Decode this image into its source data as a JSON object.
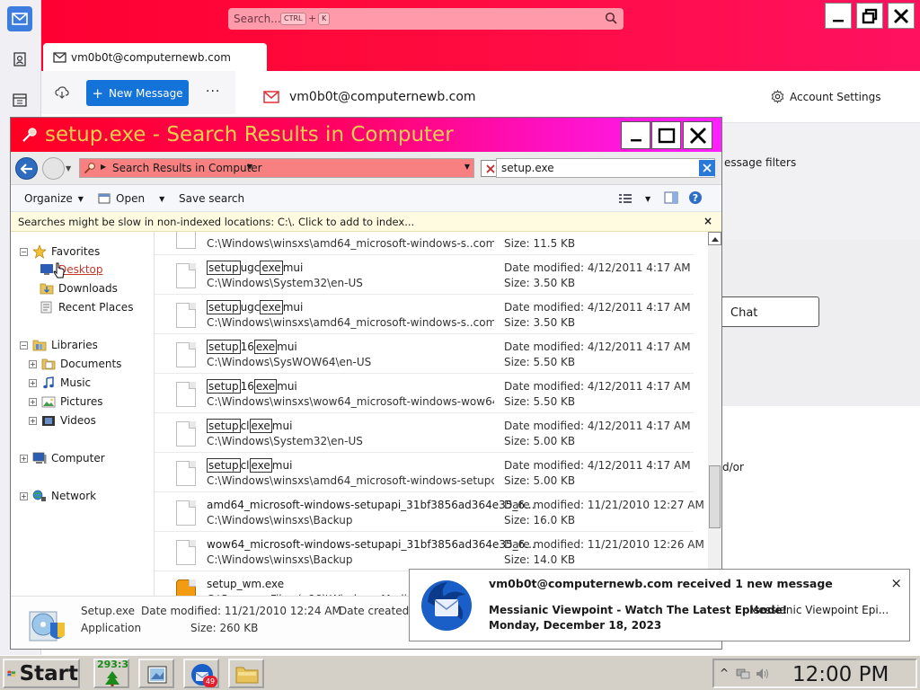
{
  "thunderbird": {
    "search_placeholder": "Search...",
    "kbd_ctrl": "CTRL",
    "kbd_plus": "+",
    "kbd_k": "K",
    "tab_label": "vm0b0t@computernewb.com",
    "new_message_label": "New Message",
    "more_label": "···",
    "header_title": "vm0b0t@computernewb.com",
    "account_settings_label": "Account Settings",
    "message_filters_fragment": "essage filters",
    "chat_label": "Chat",
    "and_or_fragment": "d/or"
  },
  "explorer": {
    "title": "setup.exe - Search Results in Computer",
    "address_text": "Search Results in Computer",
    "search_value": "setup.exe",
    "commands": {
      "organize": "Organize",
      "open": "Open",
      "save_search": "Save search"
    },
    "infobar_text": "Searches might be slow in non-indexed locations: C:\\. Click to add to index...",
    "infobar_close": "×",
    "nav": {
      "favorites": "Favorites",
      "desktop": "Desktop",
      "downloads": "Downloads",
      "recent_places": "Recent Places",
      "libraries": "Libraries",
      "documents": "Documents",
      "music": "Music",
      "pictures": "Pictures",
      "videos": "Videos",
      "computer": "Computer",
      "network": "Network"
    },
    "results": [
      {
        "name_parts": [],
        "path": "C:\\Windows\\winsxs\\amd64_microsoft-windows-s..compo...",
        "date": "",
        "size": "Size: 11.5 KB"
      },
      {
        "name_parts": [
          "setup",
          "ugc",
          "exe",
          "mui"
        ],
        "path": "C:\\Windows\\System32\\en-US",
        "date": "Date modified: 4/12/2011 4:17 AM",
        "size": "Size: 3.50 KB"
      },
      {
        "name_parts": [
          "setup",
          "ugc",
          "exe",
          "mui"
        ],
        "path": "C:\\Windows\\winsxs\\amd64_microsoft-windows-s..compo...",
        "date": "Date modified: 4/12/2011 4:17 AM",
        "size": "Size: 3.50 KB"
      },
      {
        "name_parts": [
          "setup",
          "16",
          "exe",
          "mui"
        ],
        "path": "C:\\Windows\\SysWOW64\\en-US",
        "date": "Date modified: 4/12/2011 4:17 AM",
        "size": "Size: 5.50 KB"
      },
      {
        "name_parts": [
          "setup",
          "16",
          "exe",
          "mui"
        ],
        "path": "C:\\Windows\\winsxs\\wow64_microsoft-windows-wow64.r...",
        "date": "Date modified: 4/12/2011 4:17 AM",
        "size": "Size: 5.50 KB"
      },
      {
        "name_parts": [
          "setup",
          "cl",
          "exe",
          "mui"
        ],
        "path": "C:\\Windows\\System32\\en-US",
        "date": "Date modified: 4/12/2011 4:17 AM",
        "size": "Size: 5.00 KB"
      },
      {
        "name_parts": [
          "setup",
          "cl",
          "exe",
          "mui"
        ],
        "path": "C:\\Windows\\winsxs\\amd64_microsoft-windows-setupcl.r...",
        "date": "Date modified: 4/12/2011 4:17 AM",
        "size": "Size: 5.00 KB"
      },
      {
        "name_parts": [
          "amd64_microsoft-windows-setupapi_31bf3856ad364e35_6..."
        ],
        "path": "C:\\Windows\\winsxs\\Backup",
        "date": "Date modified: 11/21/2010 12:27 AM",
        "size": "Size: 16.0 KB"
      },
      {
        "name_parts": [
          "wow64_microsoft-windows-setupapi_31bf3856ad364e35_6..."
        ],
        "path": "C:\\Windows\\winsxs\\Backup",
        "date": "Date modified: 11/21/2010 12:26 AM",
        "size": "Size: 14.0 KB"
      },
      {
        "name_parts": [
          "setup_wm.exe"
        ],
        "path": "C:\\Program Files (x86)\\Windows Media Pla",
        "date": "",
        "size": ""
      }
    ],
    "details": {
      "name": "Setup.exe",
      "type": "Application",
      "date_modified": "Date modified:  11/21/2010 12:24 AM",
      "size": "Size:  260 KB",
      "date_created": "Date created:  1"
    }
  },
  "toast": {
    "title": "vm0b0t@computernewb.com received 1 new message",
    "subject": "Messianic Viewpoint - Watch The Latest Episode!",
    "preview": "Messianic Viewpoint Epi...",
    "date": "Monday, December 18, 2023",
    "close": "×"
  },
  "taskbar": {
    "start_label": "Start",
    "tray_counter": "293:3",
    "mail_badge": "49",
    "clock": "12:00 PM"
  }
}
